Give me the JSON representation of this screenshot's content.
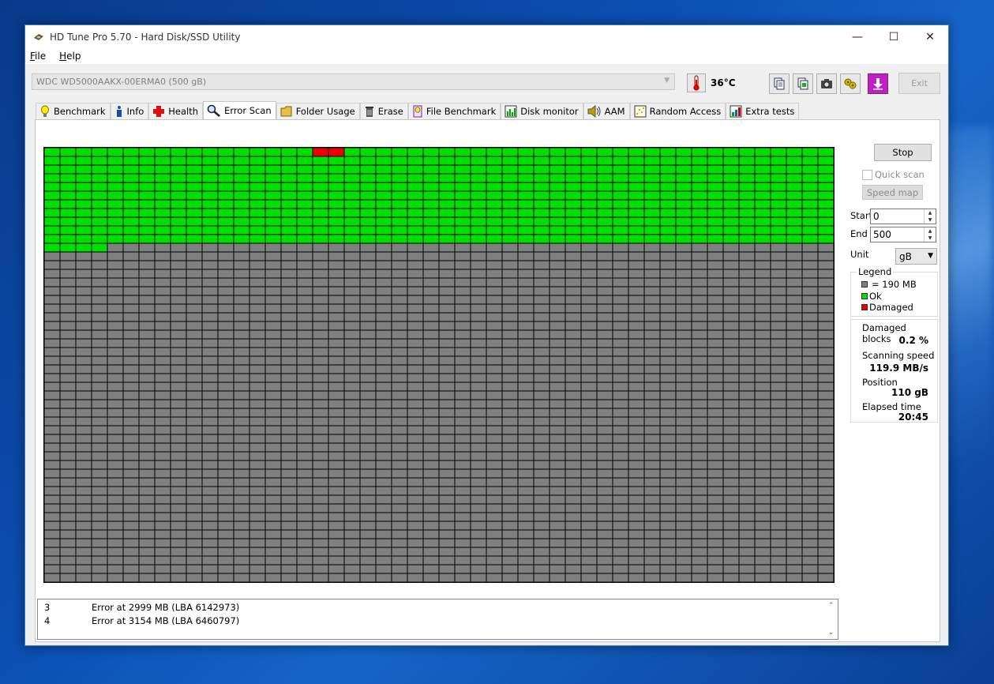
{
  "window": {
    "title": "HD Tune Pro 5.70 - Hard Disk/SSD Utility",
    "controls": {
      "minimize": "—",
      "maximize": "☐",
      "close": "✕"
    }
  },
  "menu": {
    "items": [
      "File",
      "Help"
    ]
  },
  "toolbar": {
    "drive": "WDC WD5000AAKX-00ERMA0 (500 gB)",
    "temperature": "36°C",
    "exit_label": "Exit"
  },
  "tabs": [
    {
      "label": "Benchmark",
      "icon": "benchmark-icon"
    },
    {
      "label": "Info",
      "icon": "info-icon"
    },
    {
      "label": "Health",
      "icon": "health-icon"
    },
    {
      "label": "Error Scan",
      "icon": "magnifier-icon",
      "active": true
    },
    {
      "label": "Folder Usage",
      "icon": "folder-icon"
    },
    {
      "label": "Erase",
      "icon": "trash-icon"
    },
    {
      "label": "File Benchmark",
      "icon": "file-benchmark-icon"
    },
    {
      "label": "Disk monitor",
      "icon": "disk-monitor-icon"
    },
    {
      "label": "AAM",
      "icon": "speaker-icon"
    },
    {
      "label": "Random Access",
      "icon": "random-access-icon"
    },
    {
      "label": "Extra tests",
      "icon": "extra-tests-icon"
    }
  ],
  "scan_map": {
    "columns": 50,
    "rows": 50,
    "completed_rows": 11,
    "extra_completed_cells": 4,
    "damaged_cells": [
      17,
      18
    ],
    "colors": {
      "ok": "#00e000",
      "damaged": "#ee0000",
      "pending": "#808080"
    }
  },
  "side": {
    "stop_label": "Stop",
    "quick_scan_label": "Quick scan",
    "speed_map_label": "Speed map",
    "start_label": "Start",
    "start_value": "0",
    "end_label": "End",
    "end_value": "500",
    "unit_label": "Unit",
    "unit_value": "gB",
    "legend": {
      "title": "Legend",
      "block_size": "= 190 MB",
      "ok": "Ok",
      "damaged": "Damaged"
    },
    "stats": {
      "damaged_blocks_label": "Damaged blocks",
      "damaged_blocks_value": "0.2 %",
      "scanning_speed_label": "Scanning speed",
      "scanning_speed_value": "119.9 MB/s",
      "position_label": "Position",
      "position_value": "110 gB",
      "elapsed_label": "Elapsed time",
      "elapsed_value": "20:45"
    }
  },
  "log": [
    {
      "n": "3",
      "text": "Error at 2999 MB (LBA 6142973)"
    },
    {
      "n": "4",
      "text": "Error at 3154 MB (LBA 6460797)"
    }
  ]
}
